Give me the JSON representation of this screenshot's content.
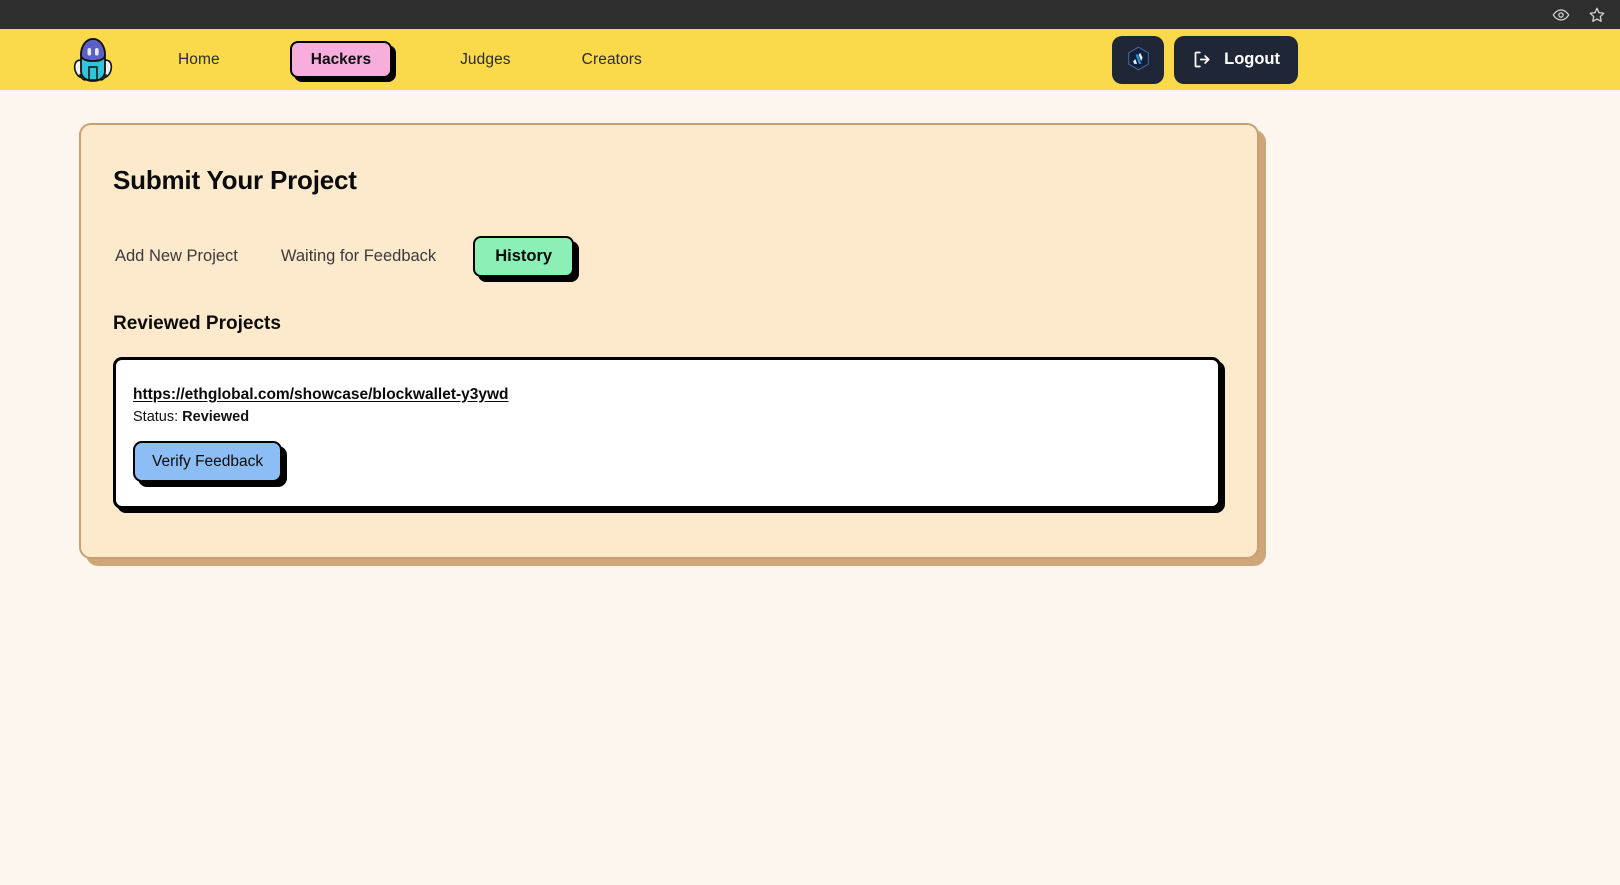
{
  "browser_bar": {
    "icons": [
      {
        "name": "eye-icon",
        "glyph": "eye"
      },
      {
        "name": "star-icon",
        "glyph": "star"
      }
    ]
  },
  "navbar": {
    "logo": {
      "name": "rocket-logo",
      "alt": "Rocket logo"
    },
    "links": [
      {
        "label": "Home",
        "active": false
      },
      {
        "label": "Hackers",
        "active": true
      },
      {
        "label": "Judges",
        "active": false
      },
      {
        "label": "Creators",
        "active": false
      }
    ],
    "chain_button": {
      "icon": "arbitrum-icon",
      "label": ""
    },
    "logout": {
      "label": "Logout",
      "icon": "logout-icon"
    },
    "colors": {
      "background": "#fada4b",
      "active_pill": "#f7aedd",
      "button_dark": "#1f2736"
    }
  },
  "panel": {
    "title": "Submit Your Project",
    "tabs": [
      {
        "label": "Add New Project",
        "active": false
      },
      {
        "label": "Waiting for Feedback",
        "active": false
      },
      {
        "label": "History",
        "active": true
      }
    ],
    "section_title": "Reviewed Projects",
    "projects": [
      {
        "url": "https://ethglobal.com/showcase/blockwallet-y3ywd",
        "status_label": "Status:",
        "status_value": "Reviewed",
        "action_label": "Verify Feedback"
      }
    ],
    "colors": {
      "background": "#fdeacd",
      "shadow": "#cfa678",
      "active_tab": "#8cf0b6",
      "action_button": "#8dbdf5"
    }
  }
}
